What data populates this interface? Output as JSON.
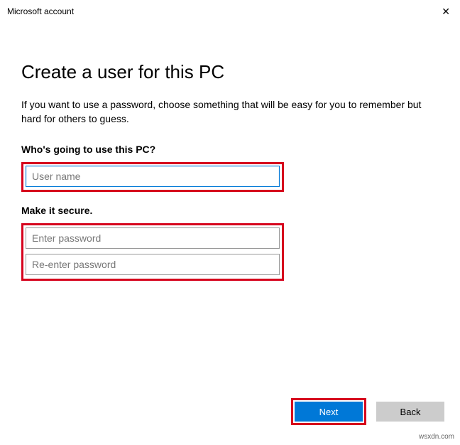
{
  "window": {
    "title": "Microsoft account"
  },
  "page": {
    "heading": "Create a user for this PC",
    "description": "If you want to use a password, choose something that will be easy for you to remember but hard for others to guess."
  },
  "section_user": {
    "label": "Who's going to use this PC?",
    "username_placeholder": "User name"
  },
  "section_secure": {
    "label": "Make it secure.",
    "password_placeholder": "Enter password",
    "reenter_placeholder": "Re-enter password"
  },
  "footer": {
    "next_label": "Next",
    "back_label": "Back"
  },
  "watermark": "wsxdn.com"
}
